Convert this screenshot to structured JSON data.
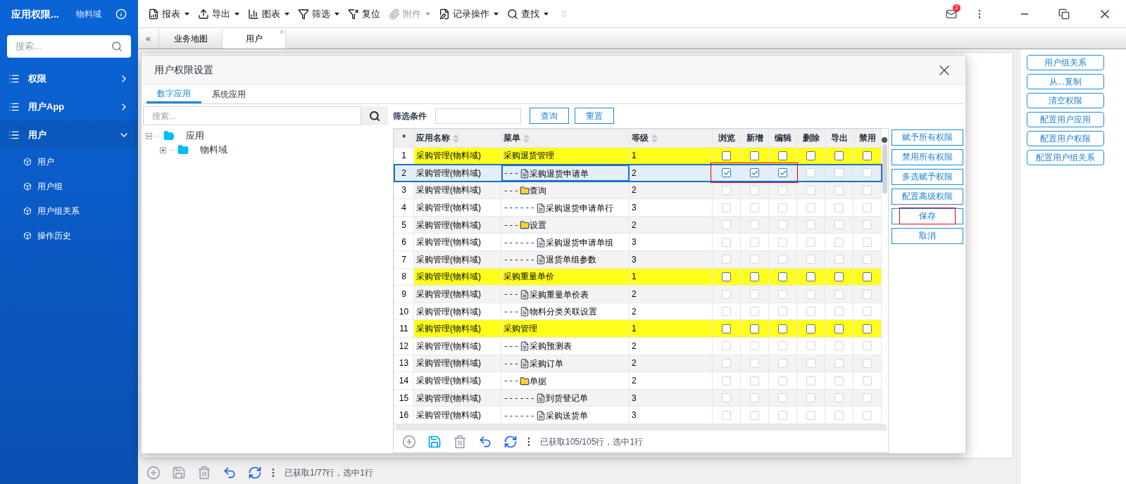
{
  "sidebar": {
    "title": "应用权限...",
    "domain": "物料域",
    "search_placeholder": "搜索...",
    "items": [
      {
        "label": "权限",
        "expanded": false,
        "selected": false
      },
      {
        "label": "用户App",
        "expanded": false,
        "selected": false
      },
      {
        "label": "用户",
        "expanded": true,
        "selected": true,
        "children": [
          {
            "label": "用户"
          },
          {
            "label": "用户组"
          },
          {
            "label": "用户组关系"
          },
          {
            "label": "操作历史"
          }
        ]
      }
    ]
  },
  "toolbar": [
    {
      "kind": "report",
      "label": "报表",
      "dropdown": true,
      "disabled": false
    },
    {
      "kind": "export",
      "label": "导出",
      "dropdown": true,
      "disabled": false
    },
    {
      "kind": "chart",
      "label": "图表",
      "dropdown": true,
      "disabled": false
    },
    {
      "kind": "filter",
      "label": "筛选",
      "dropdown": true,
      "disabled": false
    },
    {
      "kind": "reset",
      "label": "复位",
      "dropdown": false,
      "disabled": false
    },
    {
      "kind": "attach",
      "label": "附件",
      "dropdown": true,
      "disabled": true
    },
    {
      "kind": "record",
      "label": "记录操作",
      "dropdown": true,
      "disabled": false
    },
    {
      "kind": "search",
      "label": "查找",
      "dropdown": true,
      "disabled": false
    }
  ],
  "mail_badge": "2",
  "tabs": [
    {
      "label": "业务地图",
      "selected": false,
      "closable": false
    },
    {
      "label": "用户",
      "selected": true,
      "closable": true
    }
  ],
  "tab_close": "×",
  "tab_collapse": "«",
  "status_bar": "已获取1/77行，选中1行",
  "right_buttons": [
    "用户组关系",
    "从...复制",
    "清空权限",
    "配置用户应用",
    "配置用户权限",
    "配置用户组关系"
  ],
  "dialog": {
    "title": "用户权限设置",
    "tabs": [
      {
        "label": "数字应用",
        "selected": true
      },
      {
        "label": "系统应用",
        "selected": false
      }
    ],
    "tree_search_placeholder": "搜索...",
    "tree": [
      {
        "label": "应用",
        "expanded": true,
        "children": [
          {
            "label": "物料域",
            "expanded": false
          }
        ]
      }
    ],
    "filter_label": "筛选条件",
    "query_button": "查询",
    "reset_button": "重置",
    "columns": [
      "*",
      "应用名称",
      "菜单",
      "等级",
      "浏览",
      "新增",
      "编辑",
      "删除",
      "导出",
      "禁用"
    ],
    "rows": [
      {
        "no": "1",
        "app": "采购管理(物料域)",
        "prefix": "",
        "menu": "采购退货管理",
        "level": "1",
        "kind": "group",
        "selected": false,
        "annotated": false,
        "checks": [
          false,
          false,
          false,
          false,
          false,
          false
        ]
      },
      {
        "no": "2",
        "app": "采购管理(物料域)",
        "prefix": "---",
        "menu": "采购退货申请单",
        "level": "2",
        "kind": "document",
        "selected": true,
        "annotated": true,
        "checks": [
          true,
          true,
          true,
          false,
          false,
          false
        ]
      },
      {
        "no": "3",
        "app": "采购管理(物料域)",
        "prefix": "---",
        "menu": "查询",
        "level": "2",
        "kind": "folder",
        "selected": false,
        "annotated": false,
        "checks": [
          false,
          false,
          false,
          false,
          false,
          false
        ]
      },
      {
        "no": "4",
        "app": "采购管理(物料域)",
        "prefix": "------",
        "menu": "采购退货申请单行",
        "level": "3",
        "kind": "document",
        "selected": false,
        "annotated": false,
        "checks": [
          false,
          false,
          false,
          false,
          false,
          false
        ]
      },
      {
        "no": "5",
        "app": "采购管理(物料域)",
        "prefix": "---",
        "menu": "设置",
        "level": "2",
        "kind": "folder",
        "selected": false,
        "annotated": false,
        "checks": [
          false,
          false,
          false,
          false,
          false,
          false
        ]
      },
      {
        "no": "6",
        "app": "采购管理(物料域)",
        "prefix": "------",
        "menu": "采购退货申请单组",
        "level": "3",
        "kind": "document",
        "selected": false,
        "annotated": false,
        "checks": [
          false,
          false,
          false,
          false,
          false,
          false
        ]
      },
      {
        "no": "7",
        "app": "采购管理(物料域)",
        "prefix": "------",
        "menu": "退货单组参数",
        "level": "3",
        "kind": "document",
        "selected": false,
        "annotated": false,
        "checks": [
          false,
          false,
          false,
          false,
          false,
          false
        ]
      },
      {
        "no": "8",
        "app": "采购管理(物料域)",
        "prefix": "",
        "menu": "采购重量单价",
        "level": "1",
        "kind": "group",
        "selected": false,
        "annotated": false,
        "checks": [
          false,
          false,
          false,
          false,
          false,
          false
        ]
      },
      {
        "no": "9",
        "app": "采购管理(物料域)",
        "prefix": "---",
        "menu": "采购重量单价表",
        "level": "2",
        "kind": "document",
        "selected": false,
        "annotated": false,
        "checks": [
          false,
          false,
          false,
          false,
          false,
          false
        ]
      },
      {
        "no": "10",
        "app": "采购管理(物料域)",
        "prefix": "---",
        "menu": "物料分类关联设置",
        "level": "2",
        "kind": "document",
        "selected": false,
        "annotated": false,
        "checks": [
          false,
          false,
          false,
          false,
          false,
          false
        ]
      },
      {
        "no": "11",
        "app": "采购管理(物料域)",
        "prefix": "",
        "menu": "采购管理",
        "level": "1",
        "kind": "group",
        "selected": false,
        "annotated": false,
        "checks": [
          false,
          false,
          false,
          false,
          false,
          false
        ]
      },
      {
        "no": "12",
        "app": "采购管理(物料域)",
        "prefix": "---",
        "menu": "采购预测表",
        "level": "2",
        "kind": "document",
        "selected": false,
        "annotated": false,
        "checks": [
          false,
          false,
          false,
          false,
          false,
          false
        ]
      },
      {
        "no": "13",
        "app": "采购管理(物料域)",
        "prefix": "---",
        "menu": "采购订单",
        "level": "2",
        "kind": "document",
        "selected": false,
        "annotated": false,
        "checks": [
          false,
          false,
          false,
          false,
          false,
          false
        ]
      },
      {
        "no": "14",
        "app": "采购管理(物料域)",
        "prefix": "---",
        "menu": "单据",
        "level": "2",
        "kind": "folder",
        "selected": false,
        "annotated": false,
        "checks": [
          false,
          false,
          false,
          false,
          false,
          false
        ]
      },
      {
        "no": "15",
        "app": "采购管理(物料域)",
        "prefix": "------",
        "menu": "到货登记单",
        "level": "3",
        "kind": "document",
        "selected": false,
        "annotated": false,
        "checks": [
          false,
          false,
          false,
          false,
          false,
          false
        ]
      },
      {
        "no": "16",
        "app": "采购管理(物料域)",
        "prefix": "------",
        "menu": "采购送货单",
        "level": "3",
        "kind": "document",
        "selected": false,
        "annotated": false,
        "checks": [
          false,
          false,
          false,
          false,
          false,
          false
        ]
      }
    ],
    "side_buttons": [
      {
        "label": "赋予所有权限",
        "annotated": false
      },
      {
        "label": "禁用所有权限",
        "annotated": false
      },
      {
        "label": "多选赋予权限",
        "annotated": false
      },
      {
        "label": "配置高级权限",
        "annotated": false
      },
      {
        "label": "保存",
        "annotated": true
      },
      {
        "label": "取消",
        "annotated": false
      }
    ],
    "status": "已获取105/105行，选中1行"
  }
}
